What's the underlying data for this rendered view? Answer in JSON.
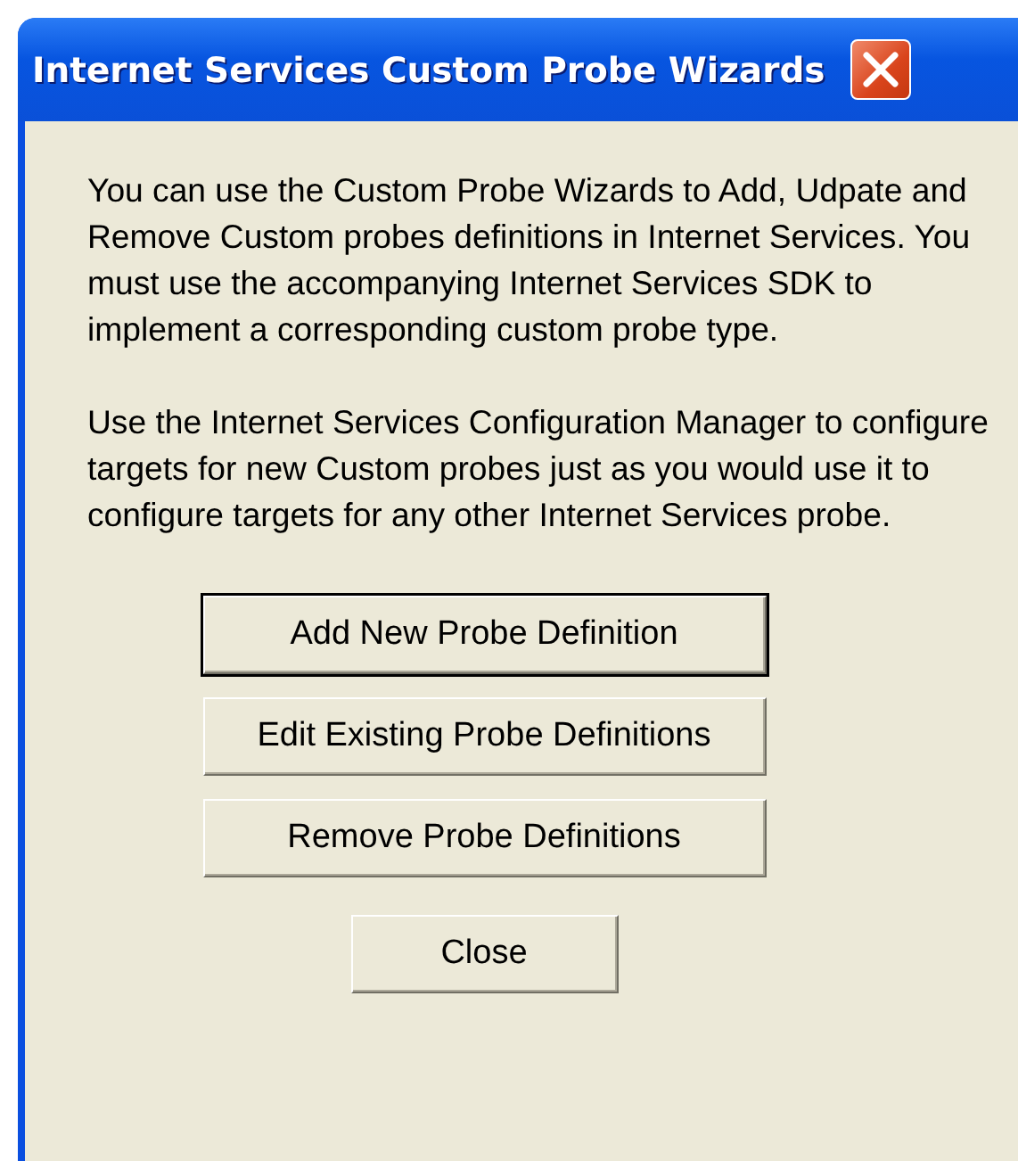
{
  "window": {
    "title": "Internet Services Custom Probe Wizards"
  },
  "paragraphs": [
    "You can use the Custom Probe Wizards to Add, Udpate and Remove Custom probes definitions in Internet Services. You must use the accompanying Internet Services SDK to implement a corresponding custom probe type.",
    "Use the Internet Services Configuration Manager to configure targets for new Custom probes just as you would use it to configure targets for any other Internet Services probe."
  ],
  "buttons": [
    {
      "label": "Add New Probe Definition",
      "default": true,
      "kind": "wide"
    },
    {
      "label": "Edit Existing Probe Definitions",
      "default": false,
      "kind": "wide"
    },
    {
      "label": "Remove Probe Definitions",
      "default": false,
      "kind": "wide"
    },
    {
      "label": "Close",
      "default": false,
      "kind": "narrow"
    }
  ]
}
